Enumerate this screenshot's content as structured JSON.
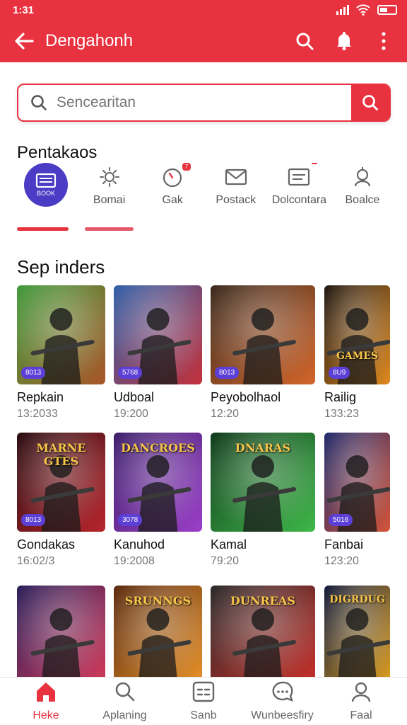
{
  "status_bar": {
    "time": "1:31"
  },
  "app_bar": {
    "title": "Dengahonh",
    "back_icon": "arrow-left-icon",
    "actions": [
      "search-icon",
      "bell-icon",
      "more-vert-icon"
    ]
  },
  "search": {
    "placeholder": "Sencearitan",
    "value": ""
  },
  "categories_title": "Pentakaos",
  "categories": [
    {
      "label": "",
      "sublabel": "BOOK",
      "icon": "book-icon",
      "active": true
    },
    {
      "label": "Bomai",
      "icon": "sun-icon",
      "active": false
    },
    {
      "label": "Gak",
      "icon": "timer-icon",
      "active": false,
      "badge": "7"
    },
    {
      "label": "Postack",
      "icon": "mail-icon",
      "active": false
    },
    {
      "label": "Dolcontara",
      "icon": "message-icon",
      "active": false,
      "badge": ""
    },
    {
      "label": "Boalce",
      "icon": "person-icon",
      "active": false
    }
  ],
  "games_title": "Sep inders",
  "games": [
    {
      "name": "Repkain",
      "time": "13:2033",
      "badge": "8013",
      "c1": "#3f9a3a",
      "c2": "#a9572a",
      "art_text": ""
    },
    {
      "name": "Udboal",
      "time": "19:200",
      "badge": "5768",
      "c1": "#2f5fa8",
      "c2": "#c3303a",
      "art_text": ""
    },
    {
      "name": "Peyobolhaol",
      "time": "12:20",
      "badge": "8013",
      "c1": "#3a2a1e",
      "c2": "#d4662a",
      "art_text": ""
    },
    {
      "name": "Railig",
      "time": "133:23",
      "badge": "8U9",
      "c1": "#1f1712",
      "c2": "#e08a20",
      "art_text": "GAMES"
    },
    {
      "name": "Gondakas",
      "time": "16:02/3",
      "badge": "8013",
      "c1": "#2a0e12",
      "c2": "#b8252c",
      "art_text": "MARNE GTES"
    },
    {
      "name": "Kanuhod",
      "time": "19:2008",
      "badge": "3078",
      "c1": "#3c1f6a",
      "c2": "#9b3fc8",
      "art_text": "DANCROES"
    },
    {
      "name": "Kamal",
      "time": "79:20",
      "badge": "",
      "c1": "#0f3a1a",
      "c2": "#3fb84a",
      "art_text": "DNARAS"
    },
    {
      "name": "Fanbai",
      "time": "123:20",
      "badge": "5016",
      "c1": "#1f2a6a",
      "c2": "#d4553a",
      "art_text": ""
    },
    {
      "name": "",
      "time": "",
      "badge": "",
      "c1": "#2a1f5a",
      "c2": "#d43a5a",
      "art_text": ""
    },
    {
      "name": "",
      "time": "",
      "badge": "",
      "c1": "#5a2a0e",
      "c2": "#e8922a",
      "art_text": "SRUNNGS"
    },
    {
      "name": "",
      "time": "",
      "badge": "",
      "c1": "#2a2a2a",
      "c2": "#c8302a",
      "art_text": "DUNREAS"
    },
    {
      "name": "",
      "time": "",
      "badge": "",
      "c1": "#101a3a",
      "c2": "#e0a020",
      "art_text": "DIGRDUG"
    }
  ],
  "bottom_nav": [
    {
      "label": "Heke",
      "icon": "home-icon",
      "active": true
    },
    {
      "label": "Aplaning",
      "icon": "search-icon",
      "active": false
    },
    {
      "label": "Sanb",
      "icon": "list-card-icon",
      "active": false
    },
    {
      "label": "Wunbeesfiry",
      "icon": "chat-bubble-icon",
      "active": false
    },
    {
      "label": "Faal",
      "icon": "profile-icon",
      "active": false
    }
  ],
  "colors": {
    "primary": "#e8323f",
    "accent": "#5b3fd6"
  }
}
